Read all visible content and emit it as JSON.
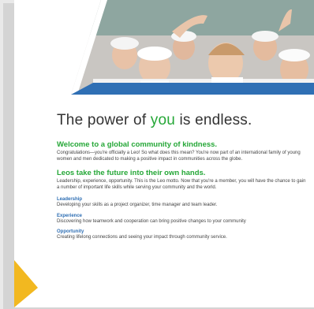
{
  "colors": {
    "accent_green": "#25a737",
    "accent_blue": "#2f6fb4",
    "brand_yellow": "#f2b820",
    "heading_gray": "#333333"
  },
  "hero": {
    "image": "photo-of-smiling-young-volunteers-in-white-caps"
  },
  "title": {
    "before": "The power of ",
    "accent": "you",
    "after": " is endless."
  },
  "section1": {
    "heading": "Welcome to a global community of kindness.",
    "body": "Congratulations—you're officially a Leo! So what does this mean? You're now part of an international family of young women and men dedicated to making a positive impact in communities across the globe."
  },
  "section2": {
    "heading": "Leos take the future into their own hands.",
    "body": "Leadership, experience, opportunity. This is the Leo motto. Now that you're a member, you will have the chance to gain a number of important life skills while serving your community and the world."
  },
  "items": [
    {
      "title": "Leadership",
      "text": "Developing your skills as a project organizer, time manager and team leader."
    },
    {
      "title": "Experience",
      "text": "Discovering how teamwork and cooperation can bring positive changes to your community"
    },
    {
      "title": "Opportunity",
      "text": "Creating lifelong connections and seeing your impact through community service."
    }
  ]
}
